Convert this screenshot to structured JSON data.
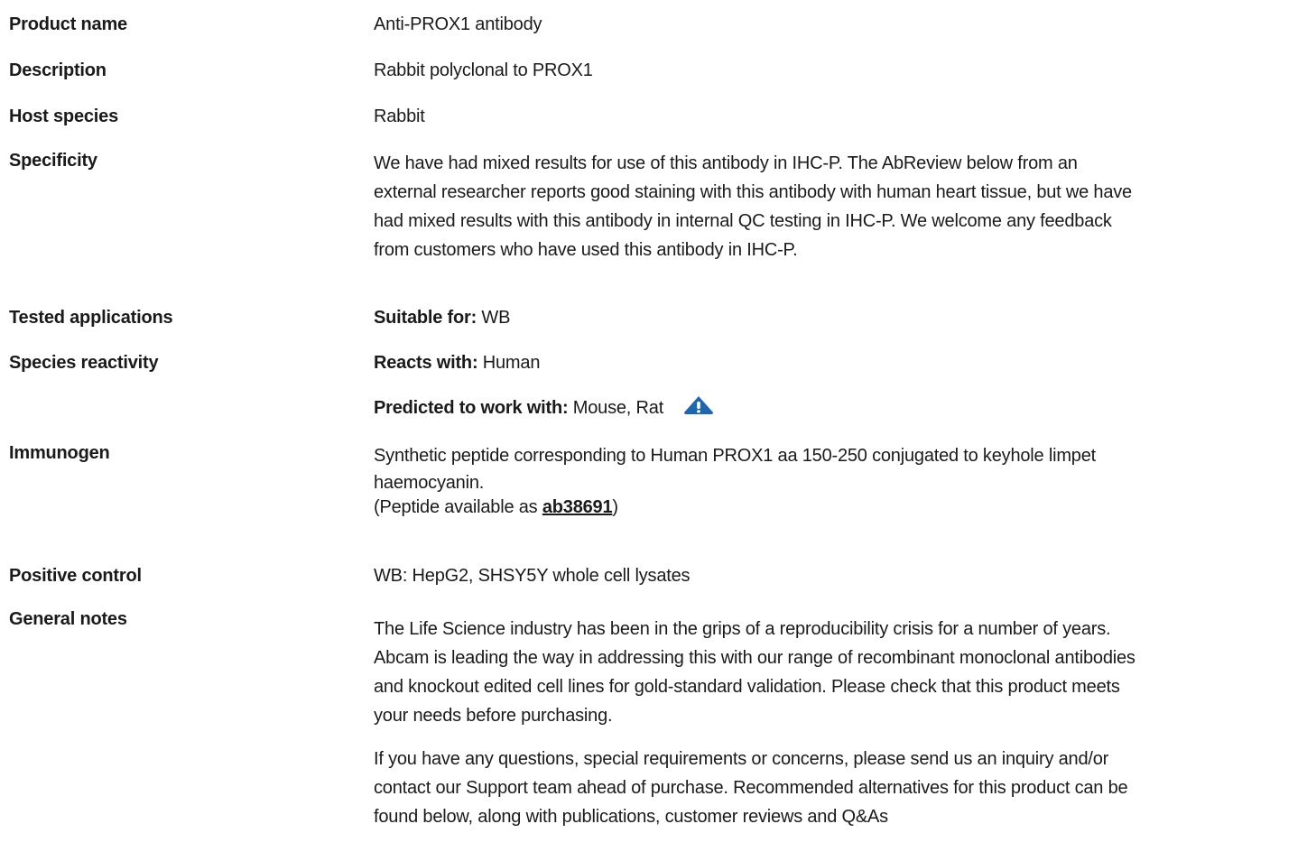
{
  "product_name": {
    "label": "Product name",
    "value": "Anti-PROX1 antibody"
  },
  "description": {
    "label": "Description",
    "value": "Rabbit polyclonal to PROX1"
  },
  "host_species": {
    "label": "Host species",
    "value": "Rabbit"
  },
  "specificity": {
    "label": "Specificity",
    "lines": [
      "We have had mixed results for use of this antibody in IHC-P. The AbReview below from an",
      "external researcher reports good staining with this antibody with human heart tissue, but we have",
      "had mixed results with this antibody in internal QC testing in IHC-P. We welcome any feedback",
      "from customers who have used this antibody in IHC-P."
    ]
  },
  "tested_applications": {
    "label": "Tested applications",
    "prefix": "Suitable for:",
    "value": " WB"
  },
  "species_reactivity": {
    "label": "Species reactivity",
    "reacts_prefix": "Reacts with:",
    "reacts_value": " Human",
    "predicted_prefix": "Predicted to work with:",
    "predicted_value": " Mouse, Rat",
    "icon": "warning-icon",
    "icon_color": "#1f66b0"
  },
  "immunogen": {
    "label": "Immunogen",
    "lines": [
      "Synthetic peptide corresponding to Human PROX1 aa 150-250 conjugated to keyhole limpet",
      "haemocyanin."
    ],
    "peptide_prefix": "(Peptide available as ",
    "peptide_link": "ab38691",
    "peptide_suffix": ")"
  },
  "positive_control": {
    "label": "Positive control",
    "value": "WB: HepG2, SHSY5Y whole cell lysates"
  },
  "general_notes": {
    "label": "General notes",
    "paragraph1": [
      "The Life Science industry has been in the grips of a reproducibility crisis for a number of years.",
      "Abcam is leading the way in addressing this with our range of recombinant monoclonal antibodies",
      "and knockout edited cell lines for gold-standard validation. Please check that this product meets",
      "your needs before purchasing."
    ],
    "paragraph2": [
      "If you have any questions, special requirements or concerns, please send us an inquiry and/or",
      "contact our Support team ahead of purchase. Recommended alternatives for this product can be",
      "found below, along with publications, customer reviews and Q&As"
    ]
  }
}
